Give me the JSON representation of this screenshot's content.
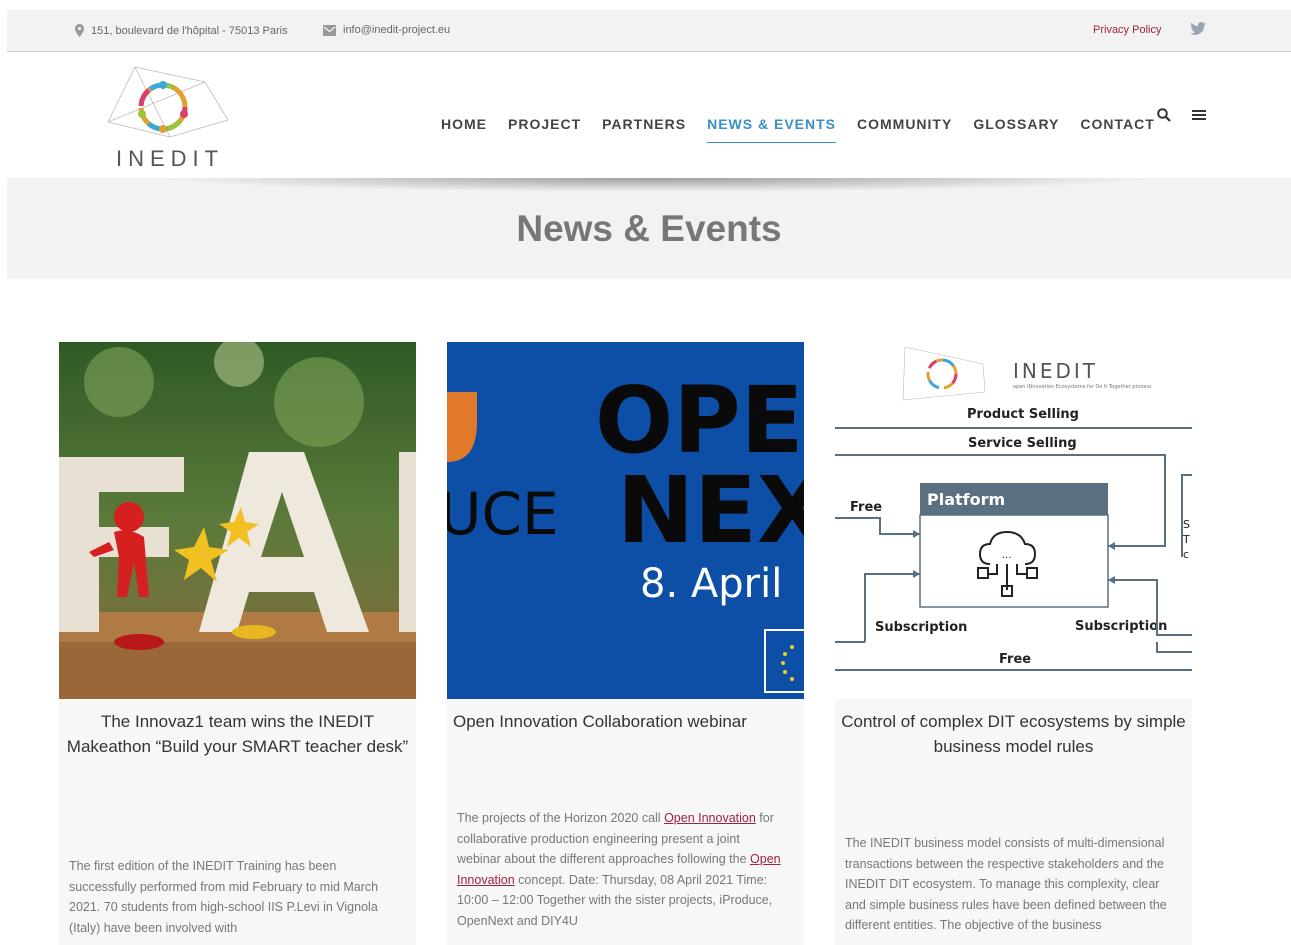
{
  "topbar": {
    "address": "151, boulevard de l'hôpital - 75013 Paris",
    "email": "info@inedit-project.eu",
    "privacy": "Privacy Policy"
  },
  "logo": {
    "text": "INEDIT"
  },
  "nav": {
    "items": [
      "HOME",
      "PROJECT",
      "PARTNERS",
      "NEWS & EVENTS",
      "COMMUNITY",
      "GLOSSARY",
      "CONTACT"
    ]
  },
  "hero": {
    "title": "News & Events"
  },
  "cards": [
    {
      "title": "The Innovaz1 team wins the INEDIT Makeathon “Build your SMART teacher desk”",
      "body": "The first edition of the INEDIT Training has been successfully performed from mid February to mid March 2021. 70 students from high-school IIS P.Levi in Vignola (Italy) have been involved with"
    },
    {
      "title": "Open Innovation Collaboration webinar",
      "image_text": {
        "line1": "OPEN",
        "line2": "NEXT",
        "prefix": "UCE",
        "date": "8. April"
      },
      "body_parts": [
        "The projects of the Horizon 2020 call ",
        "Open Innovation",
        " for collaborative production engineering present a joint webinar about the different approaches following the ",
        "Open Innovation",
        " concept. Date: Thursday, 08 April 2021 Time: 10:00 – 12:00   Together with the sister projects, iProduce, OpenNext and DIY4U"
      ]
    },
    {
      "title": "Control of complex DIT ecosystems by simple business model rules",
      "image_text": {
        "brand": "INEDIT",
        "tagline": "open INnovation Ecosystems for Do It Together process",
        "product_selling": "Product Selling",
        "service_selling": "Service Selling",
        "platform": "Platform",
        "free_left": "Free",
        "subscription_left": "Subscription",
        "subscription_right": "Subscription",
        "free_bottom": "Free",
        "dots": "...",
        "cut_s": "S",
        "cut_t": "T",
        "cut_c": "c"
      },
      "body": "The INEDIT business model consists of multi-dimensional transactions between the respective stakeholders and the INEDIT DIT ecosystem. To manage this complexity, clear and simple business rules have been defined between the different entities. The objective of the business"
    }
  ],
  "colors": {
    "accent": "#3b8fc4",
    "link": "#a0223f",
    "hero_bg": "#f2f2f2",
    "eu_blue": "#0d4ea6"
  }
}
